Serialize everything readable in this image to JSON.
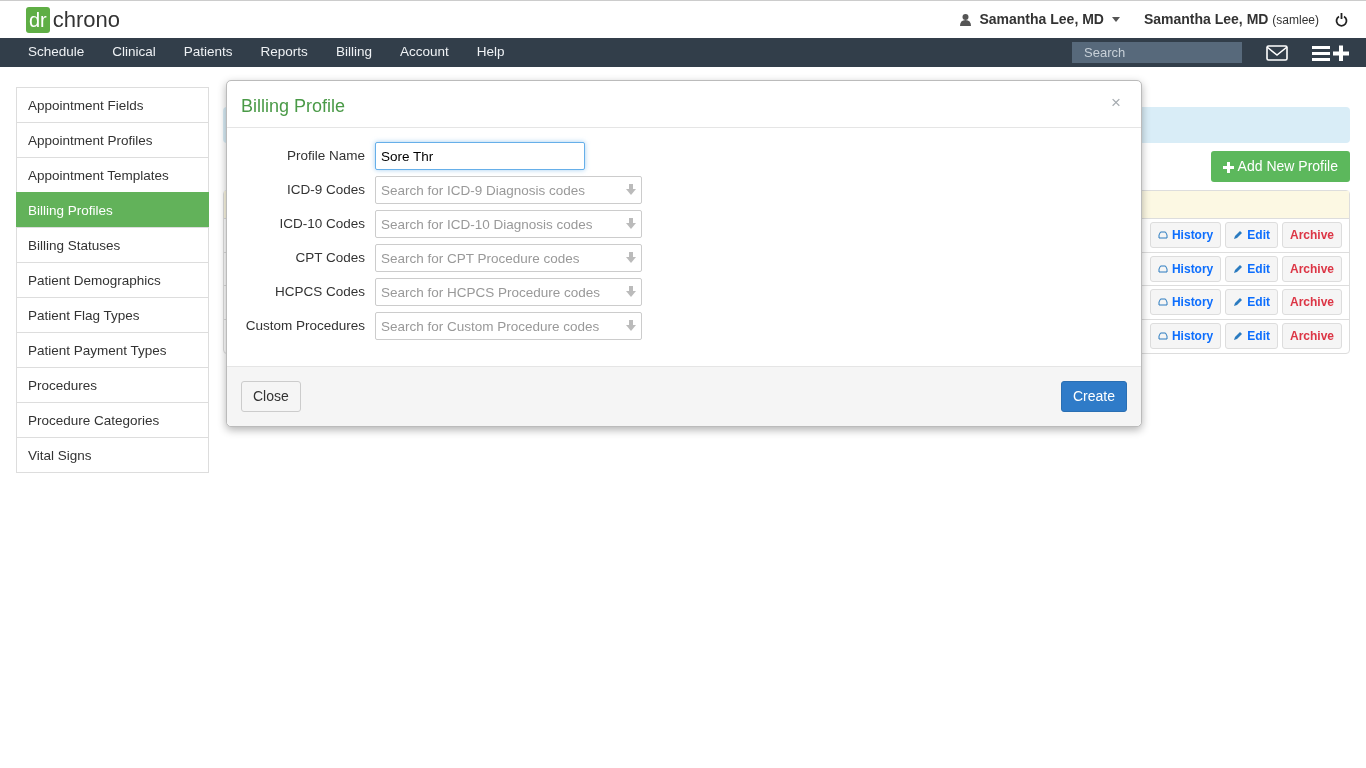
{
  "brand": {
    "badge": "dr",
    "name": "chrono"
  },
  "user_menu": {
    "name": "Samantha Lee, MD"
  },
  "account": {
    "name": "Samantha Lee, MD",
    "username": "(samlee)"
  },
  "nav": [
    "Schedule",
    "Clinical",
    "Patients",
    "Reports",
    "Billing",
    "Account",
    "Help"
  ],
  "search": {
    "placeholder": "Search"
  },
  "sidebar": {
    "items": [
      {
        "label": "Appointment Fields",
        "selected": false
      },
      {
        "label": "Appointment Profiles",
        "selected": false
      },
      {
        "label": "Appointment Templates",
        "selected": false
      },
      {
        "label": "Billing Profiles",
        "selected": true
      },
      {
        "label": "Billing Statuses",
        "selected": false
      },
      {
        "label": "Patient Demographics",
        "selected": false
      },
      {
        "label": "Patient Flag Types",
        "selected": false
      },
      {
        "label": "Patient Payment Types",
        "selected": false
      },
      {
        "label": "Procedures",
        "selected": false
      },
      {
        "label": "Procedure Categories",
        "selected": false
      },
      {
        "label": "Vital Signs",
        "selected": false
      }
    ]
  },
  "add_button": "Add New Profile",
  "rows": [
    {
      "history": "History",
      "edit": "Edit",
      "archive": "Archive"
    },
    {
      "history": "History",
      "edit": "Edit",
      "archive": "Archive"
    },
    {
      "history": "History",
      "edit": "Edit",
      "archive": "Archive"
    },
    {
      "history": "History",
      "edit": "Edit",
      "archive": "Archive"
    }
  ],
  "modal": {
    "title": "Billing Profile",
    "close": "×",
    "fields": [
      {
        "label": "Profile Name",
        "kind": "text",
        "value": "Sore Thr"
      },
      {
        "label": "ICD-9 Codes",
        "kind": "select",
        "placeholder": "Search for ICD-9 Diagnosis codes"
      },
      {
        "label": "ICD-10 Codes",
        "kind": "select",
        "placeholder": "Search for ICD-10 Diagnosis codes"
      },
      {
        "label": "CPT Codes",
        "kind": "select",
        "placeholder": "Search for CPT Procedure codes"
      },
      {
        "label": "HCPCS Codes",
        "kind": "select",
        "placeholder": "Search for HCPCS Procedure codes"
      },
      {
        "label": "Custom Procedures",
        "kind": "select",
        "placeholder": "Search for Custom Procedure codes"
      }
    ],
    "buttons": {
      "close": "Close",
      "create": "Create"
    }
  }
}
